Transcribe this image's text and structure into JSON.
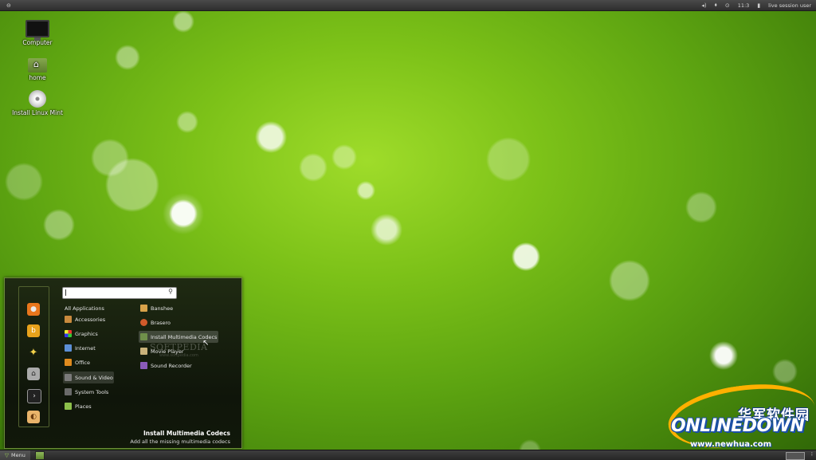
{
  "top_panel": {
    "left_icon": "link-icon",
    "time": "11:3",
    "user": "live session user"
  },
  "desktop": {
    "icons": [
      {
        "label": "Computer",
        "icon": "monitor-icon"
      },
      {
        "label": "home",
        "icon": "home-folder-icon"
      },
      {
        "label": "Install Linux Mint",
        "icon": "disc-icon"
      }
    ]
  },
  "menu": {
    "search_value": "",
    "categories": [
      {
        "label": "All Applications",
        "color": ""
      },
      {
        "label": "Accessories",
        "color": "#c98a3d"
      },
      {
        "label": "Graphics",
        "color": "#d33a8a"
      },
      {
        "label": "Internet",
        "color": "#5c8fd6"
      },
      {
        "label": "Office",
        "color": "#e08a1e"
      },
      {
        "label": "Sound & Video",
        "color": "#7a7a7a"
      },
      {
        "label": "System Tools",
        "color": "#6a6a6a"
      },
      {
        "label": "Places",
        "color": "#8cbf4a"
      }
    ],
    "apps": [
      {
        "label": "Banshee",
        "color": "#d8a24a"
      },
      {
        "label": "Brasero",
        "color": "#d05a2a"
      },
      {
        "label": "Install Multimedia Codecs",
        "color": "#6f8f4a"
      },
      {
        "label": "Movie Player",
        "color": "#c9b27a"
      },
      {
        "label": "Sound Recorder",
        "color": "#8a5ab8"
      }
    ],
    "watermark": "SOFTPEDIA",
    "watermark_url": "www.softpedia.com",
    "description_title": "Install Multimedia Codecs",
    "description_text": "Add all the missing multimedia codecs",
    "favorites": [
      {
        "icon": "firefox-icon",
        "color": "#e8761c"
      },
      {
        "icon": "banshee-icon",
        "color": "#e8a21c"
      },
      {
        "icon": "star-icon",
        "color": "#f2d14a"
      },
      {
        "icon": "package-icon",
        "color": "#cccccc"
      },
      {
        "icon": "terminal-icon",
        "color": "#333333"
      },
      {
        "icon": "logout-icon",
        "color": "#e9b36a"
      }
    ]
  },
  "bottom_panel": {
    "menu_label": "Menu"
  },
  "logo": {
    "chinese": "华军软件园",
    "brand": "ONLINEDOWN",
    "url": "www.newhua.com"
  }
}
